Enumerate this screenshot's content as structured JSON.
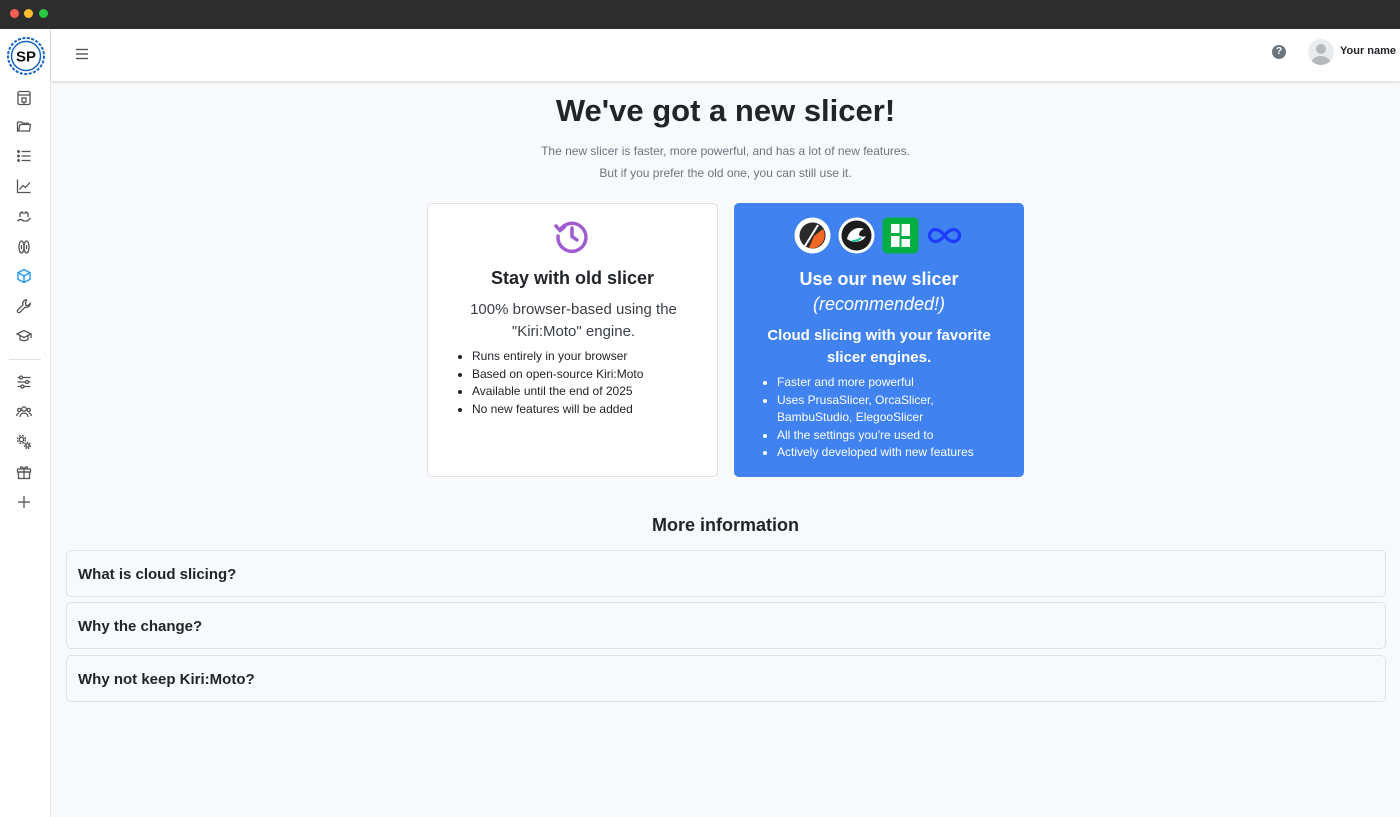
{
  "header": {
    "logo_text": "SP",
    "user_name": "Your name",
    "help_symbol": "?"
  },
  "sidebar": {
    "items": [
      {
        "icon": "printer-icon"
      },
      {
        "icon": "folder-icon"
      },
      {
        "icon": "list-icon"
      },
      {
        "icon": "chart-line-icon"
      },
      {
        "icon": "tray-hand-icon"
      },
      {
        "icon": "filament-icon"
      },
      {
        "icon": "cube-icon",
        "active": true
      },
      {
        "icon": "wrench-icon"
      },
      {
        "icon": "graduation-cap-icon"
      },
      {
        "icon": "sliders-icon"
      },
      {
        "icon": "users-icon"
      },
      {
        "icon": "gears-icon"
      },
      {
        "icon": "gift-icon"
      },
      {
        "icon": "plus-icon"
      }
    ],
    "active_color": "#2196f3"
  },
  "main": {
    "title": "We've got a new slicer!",
    "subtitle_line1": "The new slicer is faster, more powerful, and has a lot of new features.",
    "subtitle_line2": "But if you prefer the old one, you can still use it."
  },
  "old_card": {
    "title": "Stay with old slicer",
    "description": "100% browser-based using the \"Kiri:Moto\" engine.",
    "bullets": [
      "Runs entirely in your browser",
      "Based on open-source Kiri:Moto",
      "Available until the end of 2025",
      "No new features will be added"
    ],
    "icon": "history-icon",
    "icon_color": "#a05cd0"
  },
  "new_card": {
    "title": "Use our new slicer",
    "recommended": "(recommended!)",
    "description": "Cloud slicing with your favorite slicer engines.",
    "bullets": [
      "Faster and more powerful",
      "Uses PrusaSlicer, OrcaSlicer, BambuStudio, ElegooSlicer",
      "All the settings you're used to",
      "Actively developed with new features"
    ],
    "engine_icons": [
      "prusaslicer-icon",
      "orcaslicer-icon",
      "bambustudio-icon",
      "elegooslicer-icon"
    ],
    "background_color": "#3f82f0"
  },
  "more_info": {
    "title": "More information",
    "faq": [
      "What is cloud slicing?",
      "Why the change?",
      "Why not keep Kiri:Moto?"
    ]
  }
}
